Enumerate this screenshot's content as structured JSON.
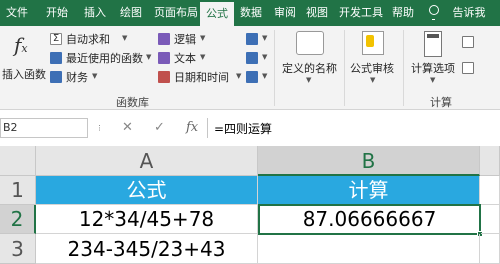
{
  "colors": {
    "brand": "#217346",
    "header_fill": "#29a8e0"
  },
  "tabs": [
    {
      "label": "文件"
    },
    {
      "label": "开始"
    },
    {
      "label": "插入"
    },
    {
      "label": "绘图"
    },
    {
      "label": "页面布局"
    },
    {
      "label": "公式"
    },
    {
      "label": "数据"
    },
    {
      "label": "审阅"
    },
    {
      "label": "视图"
    },
    {
      "label": "开发工具"
    },
    {
      "label": "帮助"
    }
  ],
  "active_tab": "公式",
  "tell_me": {
    "label": "告诉我",
    "icon": "lightbulb-icon"
  },
  "ribbon": {
    "insert_function": {
      "label": "插入函数",
      "icon": "fx-icon"
    },
    "autosum": {
      "label": "自动求和",
      "icon": "sigma-icon"
    },
    "recent": {
      "label": "最近使用的函数",
      "icon": "star-icon"
    },
    "financial": {
      "label": "财务",
      "icon": "book-icon"
    },
    "logical": {
      "label": "逻辑",
      "icon": "question-book-icon"
    },
    "text": {
      "label": "文本",
      "icon": "text-icon"
    },
    "datetime": {
      "label": "日期和时间",
      "icon": "clock-icon"
    },
    "lookup": {
      "icon": "lookup-icon"
    },
    "math": {
      "icon": "theta-icon"
    },
    "more": {
      "icon": "more-functions-icon"
    },
    "group_library": "函数库",
    "defined_names": {
      "label": "定义的名称",
      "icon": "tag-icon"
    },
    "formula_audit": {
      "label": "公式审核",
      "icon": "audit-icon"
    },
    "calc_options": {
      "label": "计算选项",
      "icon": "calculator-icon"
    },
    "calc_now": {
      "icon": "calc-sheet-icon"
    },
    "group_calc": "计算"
  },
  "formula_bar": {
    "name_box": "B2",
    "cancel_symbol": "✕",
    "enter_symbol": "✓",
    "fx_symbol": "fx",
    "formula": "=四则运算"
  },
  "sheet": {
    "columns": [
      "A",
      "B"
    ],
    "rows": [
      {
        "num": "1",
        "a": "公式",
        "b": "计算"
      },
      {
        "num": "2",
        "a": "12*34/45+78",
        "b": "87.06666667"
      },
      {
        "num": "3",
        "a": "234-345/23+43",
        "b": ""
      }
    ],
    "active_cell": "B2"
  }
}
